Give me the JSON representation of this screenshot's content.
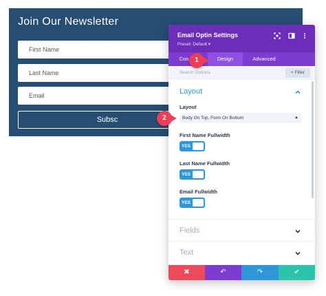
{
  "newsletter": {
    "title": "Join Our Newsletter",
    "first_name_placeholder": "First Name",
    "last_name_placeholder": "Last Name",
    "email_placeholder": "Email",
    "subscribe_label": "Subsc"
  },
  "panel": {
    "title": "Email Optin Settings",
    "preset": "Preset: Default ▾",
    "header_icons": [
      "fullscreen-icon",
      "split-view-icon",
      "more-icon"
    ],
    "tabs": [
      {
        "label": "Con",
        "active": false
      },
      {
        "label": "Design",
        "active": true
      },
      {
        "label": "Advanced",
        "active": false
      }
    ],
    "search_placeholder": "Search Options",
    "filter_label": "+ Filter",
    "layout_section": {
      "title": "Layout",
      "layout_label": "Layout",
      "layout_value": "Body On Top, Form On Bottom",
      "toggles": [
        {
          "label": "First Name Fullwidth",
          "value": "YES"
        },
        {
          "label": "Last Name Fullwidth",
          "value": "YES"
        },
        {
          "label": "Email Fullwidth",
          "value": "YES"
        }
      ]
    },
    "collapsed_sections": [
      "Fields",
      "Text"
    ],
    "footer_buttons": [
      {
        "name": "cancel",
        "glyph": "✖",
        "color": "#ef4a5b"
      },
      {
        "name": "undo",
        "glyph": "↶",
        "color": "#7e3bd0"
      },
      {
        "name": "redo",
        "glyph": "↷",
        "color": "#2e97d8"
      },
      {
        "name": "save",
        "glyph": "✔",
        "color": "#29c4a9"
      }
    ]
  },
  "callouts": [
    "1",
    "2"
  ],
  "colors": {
    "newsletter_bg": "#264d72",
    "panel_header": "#6c2eb9",
    "tab_bar": "#7e3bd0",
    "accent_blue": "#2e97d8",
    "callout_red": "#ee3d57"
  }
}
